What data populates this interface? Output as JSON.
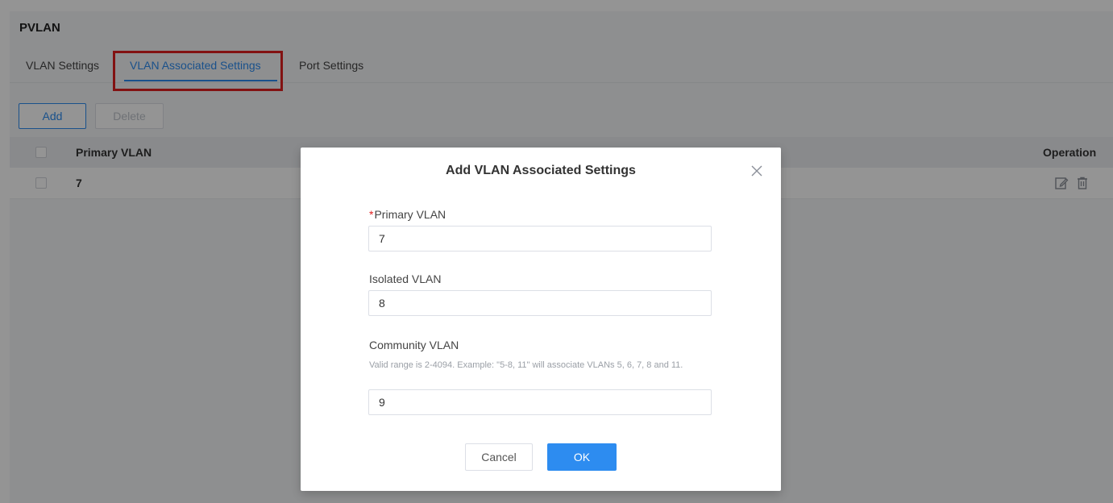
{
  "page": {
    "title": "PVLAN",
    "tabs": [
      {
        "label": "VLAN Settings",
        "active": false
      },
      {
        "label": "VLAN Associated Settings",
        "active": true
      },
      {
        "label": "Port Settings",
        "active": false
      }
    ]
  },
  "toolbar": {
    "add_label": "Add",
    "delete_label": "Delete"
  },
  "table": {
    "columns": [
      "Primary VLAN",
      "Operation"
    ],
    "rows": [
      {
        "primary_vlan": "7"
      }
    ]
  },
  "modal": {
    "title": "Add VLAN Associated Settings",
    "primary_vlan": {
      "required_mark": "*",
      "label": "Primary VLAN",
      "value": "7"
    },
    "isolated_vlan": {
      "label": "Isolated VLAN",
      "value": "8"
    },
    "community_vlan": {
      "label": "Community VLAN",
      "hint": "Valid range is 2-4094. Example: \"5-8, 11\" will associate VLANs 5, 6, 7, 8 and 11.",
      "value": "9"
    },
    "cancel_label": "Cancel",
    "ok_label": "OK"
  },
  "colors": {
    "accent": "#2d8cf0",
    "highlight_box": "#e02020",
    "required": "#e02020"
  },
  "icons": [
    "close-icon",
    "edit-icon",
    "delete-icon"
  ]
}
